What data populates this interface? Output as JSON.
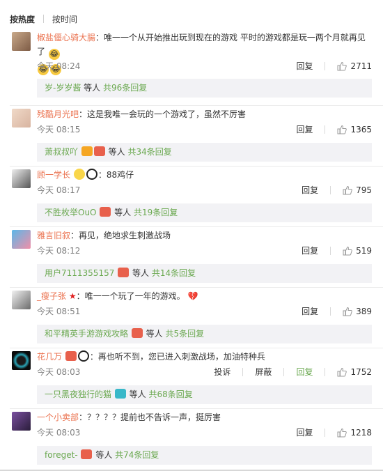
{
  "tabs": {
    "hot": "按热度",
    "time": "按时间"
  },
  "comments": [
    {
      "user": "椒盐僵心骑大腸",
      "text": "：唯一一个从开始推出玩到现在的游戏  平时的游戏都是玩一两个月就再见了",
      "time": "今天 08:24",
      "reply_label": "回复",
      "likes": "2711",
      "reply_user": "岁-岁岁酱",
      "reply_mid": "等人",
      "reply_count": "共96条回复"
    },
    {
      "user": "残酷月光吧",
      "text": "：这是我唯一会玩的一个游戏了，虽然不厉害",
      "time": "今天 08:15",
      "reply_label": "回复",
      "likes": "1365",
      "reply_user": "萧叔叔吖",
      "reply_mid": "等人",
      "reply_count": "共34条回复"
    },
    {
      "user": "顾一学长",
      "text": "：88鸡仔",
      "time": "今天 08:17",
      "reply_label": "回复",
      "likes": "795",
      "reply_user": "不胜枚举OuO",
      "reply_mid": "等人",
      "reply_count": "共19条回复"
    },
    {
      "user": "雅言旧叙",
      "text": "：再见，绝地求生刺激战场",
      "time": "今天 08:12",
      "reply_label": "回复",
      "likes": "519",
      "reply_user": "用户7111355157",
      "reply_mid": "等人",
      "reply_count": "共14条回复"
    },
    {
      "user": "_瘦子张",
      "text": "：唯一一个玩了一年的游戏。",
      "time": "今天 08:51",
      "reply_label": "回复",
      "likes": "389",
      "reply_user": "和平精英手游游戏攻略",
      "reply_mid": "等人",
      "reply_count": "共5条回复"
    },
    {
      "user": "花几万",
      "text": "：再也听不到，您已进入刺激战场，加油特种兵",
      "time": "今天 08:03",
      "report_label": "投诉",
      "block_label": "屏蔽",
      "reply_label": "回复",
      "likes": "1752",
      "reply_user": "一只黑夜独行的猫",
      "reply_mid": "等人",
      "reply_count": "共68条回复"
    },
    {
      "user": "一个小卖部",
      "text": "：？？？？提前也不告诉一声，挺厉害",
      "time": "今天 08:03",
      "reply_label": "回复",
      "likes": "1218",
      "reply_user": "foreget-",
      "reply_mid": "等人",
      "reply_count": "共74条回复"
    }
  ],
  "icons": {
    "like": "thumbs-up-icon",
    "laugh": "laughing-emoji-icon",
    "heart": "broken-heart-icon",
    "panda": "panda-emoji-icon",
    "star": "red-star-icon",
    "badge": "vip-badge-icon"
  },
  "colors": {
    "username": "#eb7350",
    "reply_green": "#6aa84f",
    "reply_bg": "#f2f2f5",
    "time": "#808080"
  }
}
